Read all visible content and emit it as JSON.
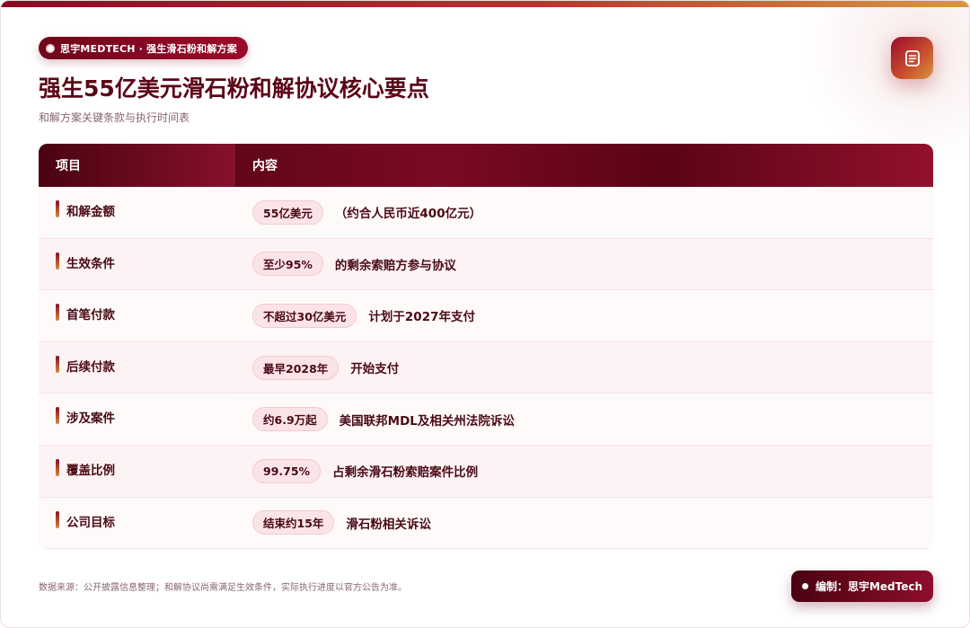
{
  "brand": {
    "label": "思宇MEDTECH · 强生滑石粉和解方案"
  },
  "header": {
    "title": "强生55亿美元滑石粉和解协议核心要点",
    "subtitle": "和解方案关键条款与执行时间表"
  },
  "action": {
    "icon": "document-list-icon"
  },
  "table": {
    "columns": [
      "项目",
      "内容"
    ],
    "rows": [
      {
        "label": "和解金额",
        "tag": "55亿美元",
        "desc": "（约合人民币近400亿元）"
      },
      {
        "label": "生效条件",
        "tag": "至少95%",
        "desc": "的剩余索赔方参与协议"
      },
      {
        "label": "首笔付款",
        "tag": "不超过30亿美元",
        "desc": "计划于2027年支付"
      },
      {
        "label": "后续付款",
        "tag": "最早2028年",
        "desc": "开始支付"
      },
      {
        "label": "涉及案件",
        "tag": "约6.9万起",
        "desc": "美国联邦MDL及相关州法院诉讼"
      },
      {
        "label": "覆盖比例",
        "tag": "99.75%",
        "desc": "占剩余滑石粉索赔案件比例"
      },
      {
        "label": "公司目标",
        "tag": "结束约15年",
        "desc": "滑石粉相关诉讼"
      }
    ]
  },
  "footer": {
    "note": "数据来源：公开披露信息整理；和解协议尚需满足生效条件，实际执行进度以官方公告为准。",
    "author": "编制：思宇MedTech"
  },
  "colors": {
    "primary": "#7a0a22",
    "accent": "#d89a3c",
    "tag_bg": "#fbe4e7"
  }
}
